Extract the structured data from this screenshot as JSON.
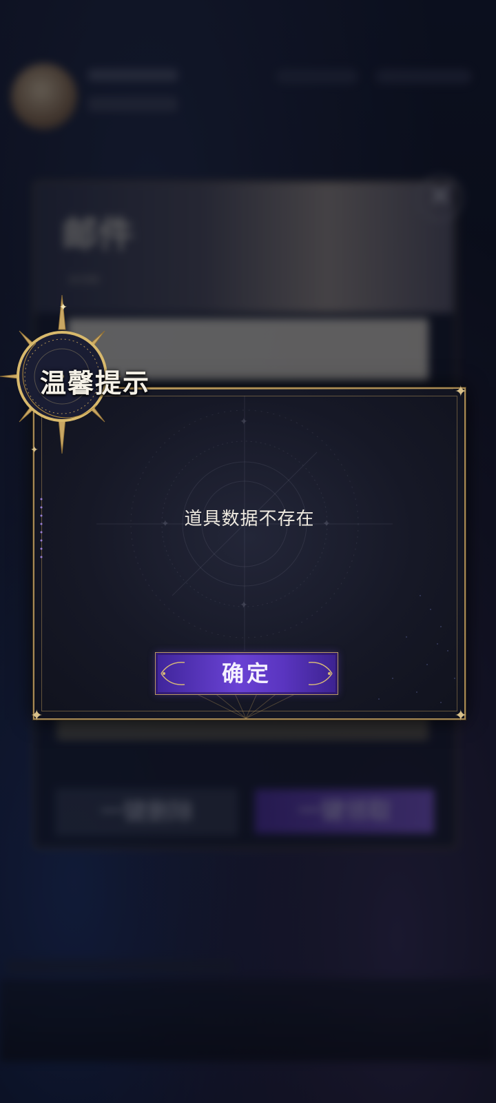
{
  "background": {
    "mail_title": "邮件",
    "mail_count": "3/100",
    "delete_all_label": "一键删除",
    "claim_all_label": "一键领取"
  },
  "dialog": {
    "title": "温馨提示",
    "message": "道具数据不存在",
    "confirm_label": "确定"
  },
  "colors": {
    "accent_gold": "#a88a55",
    "button_purple": "#6a42d4",
    "panel_dark": "#161826"
  },
  "icons": {
    "emblem": "crescent-moon-sun-emblem-icon",
    "close": "close-icon",
    "corner": "corner-star-icon"
  }
}
